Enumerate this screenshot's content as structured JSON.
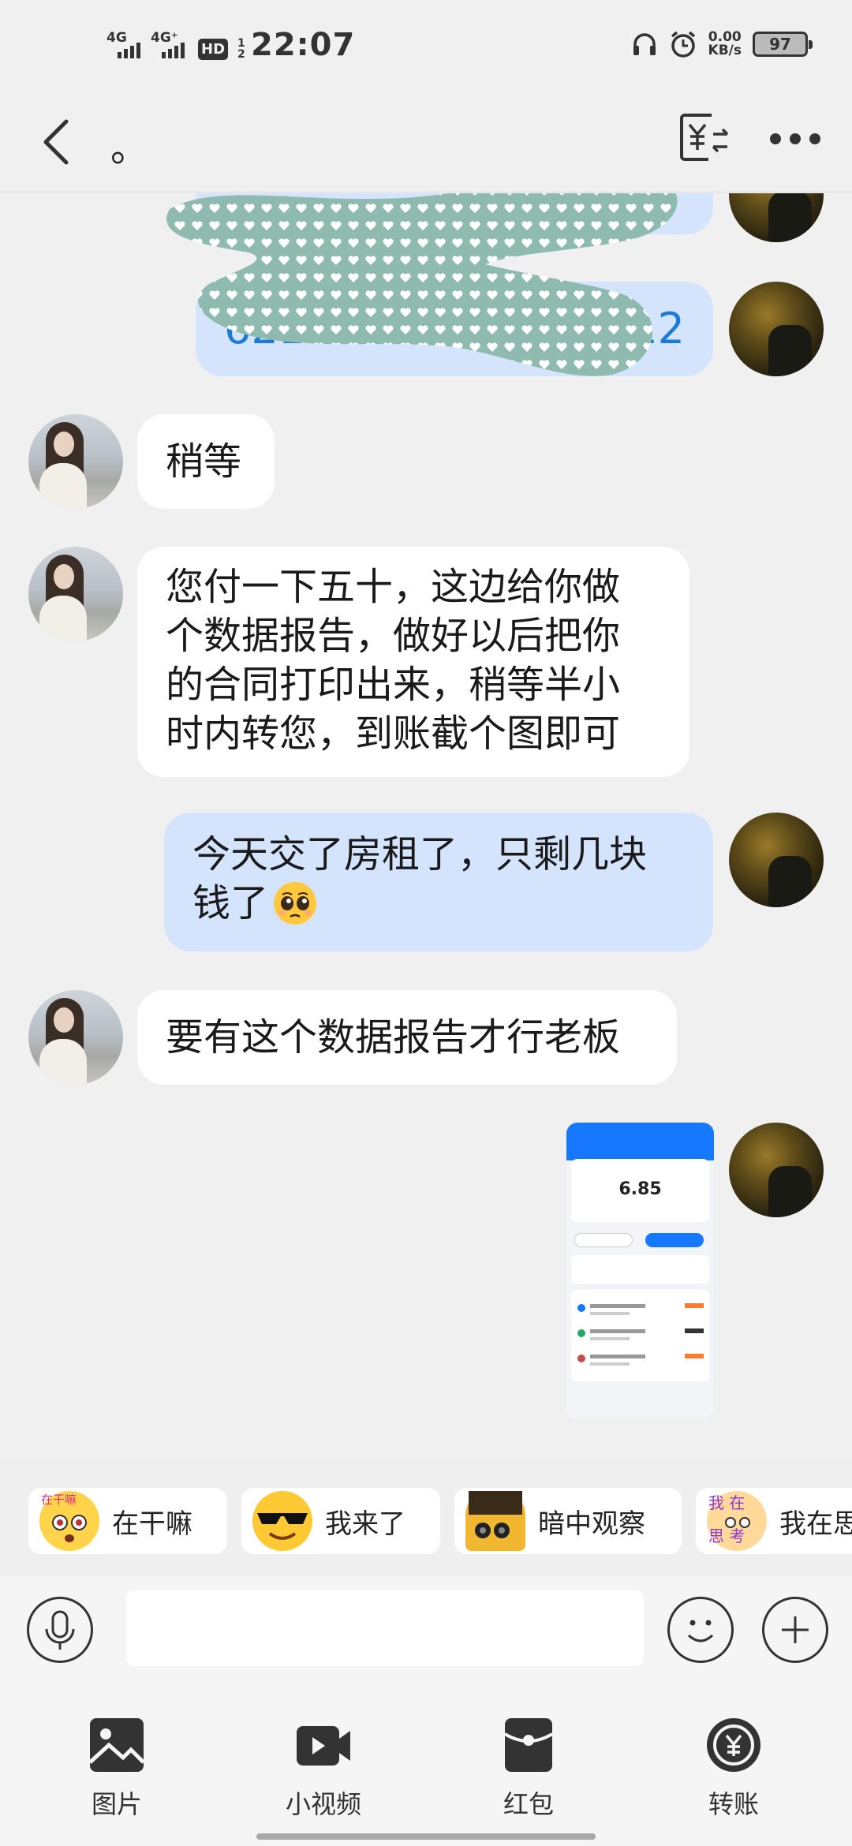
{
  "status_bar": {
    "network_1": "4G",
    "network_2": "4G⁺",
    "hd": "HD",
    "hd_sim": "1 2",
    "time": "22:07",
    "speed_value": "0.00",
    "speed_unit": "KB/s",
    "battery": "97"
  },
  "header": {
    "title": "。",
    "icons": [
      "back-arrow-icon",
      "yuan-transfer-icon",
      "more-icon"
    ]
  },
  "messages": [
    {
      "from": "me",
      "text": "6212",
      "text_end": "12",
      "note": ""
    },
    {
      "from": "her",
      "text": "稍等"
    },
    {
      "from": "her",
      "lines": [
        "您付一下五十，这边给你做",
        "个数据报告，做好以后把你",
        "的合同打印出来，稍等半小",
        "时内转您，到账截个图即可"
      ]
    },
    {
      "from": "me",
      "lines": [
        "今天交了房租了，只剩几块",
        "钱了"
      ],
      "emoji": "pleading-face"
    },
    {
      "from": "her",
      "text": "要有这个数据报告才行老板"
    },
    {
      "from": "me",
      "type": "image",
      "image_balance": "6.85"
    }
  ],
  "quick_replies": [
    {
      "label": "在干嘛",
      "sticker": "在干嘛",
      "icon": "face-sticker-icon"
    },
    {
      "label": "我来了",
      "icon": "sunglasses-face-icon"
    },
    {
      "label": "暗中观察",
      "icon": "binoculars-face-icon"
    },
    {
      "label": "我在思",
      "sticker": "我 在 思 考",
      "icon": "thinking-face-icon"
    }
  ],
  "input": {
    "placeholder": "",
    "value": ""
  },
  "toolbar": [
    {
      "label": "图片",
      "icon": "image-icon"
    },
    {
      "label": "小视频",
      "icon": "video-icon"
    },
    {
      "label": "红包",
      "icon": "red-packet-icon"
    },
    {
      "label": "转账",
      "icon": "transfer-icon"
    }
  ],
  "colors": {
    "my_bubble": "#d4e4fd",
    "her_bubble": "#ffffff",
    "account_number": "#1c7bd8",
    "scribble": "#8fbab0"
  }
}
